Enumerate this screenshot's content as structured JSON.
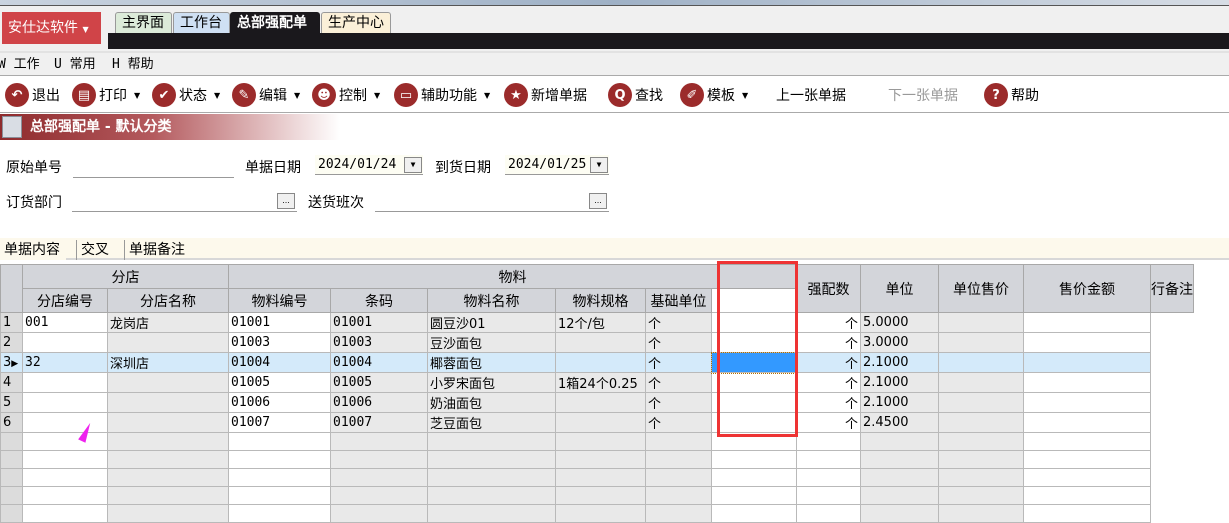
{
  "app": {
    "brand": "安仕达软件",
    "tabs": [
      {
        "label": "主界面",
        "bg": "#dcebd9"
      },
      {
        "label": "工作台",
        "bg": "#cfe0f3"
      },
      {
        "label": "总部强配单",
        "bg": "#1a181c"
      },
      {
        "label": "生产中心",
        "bg": "#fbf0d8"
      }
    ]
  },
  "menu": [
    "W 工作",
    "U 常用",
    "H 帮助"
  ],
  "toolbar": [
    {
      "label": "退出",
      "icon": "undo-icon",
      "glyph": "↶"
    },
    {
      "label": "打印",
      "icon": "printer-icon",
      "glyph": "▤",
      "dd": true
    },
    {
      "label": "状态",
      "icon": "check-icon",
      "glyph": "✔",
      "dd": true
    },
    {
      "label": "编辑",
      "icon": "pencil-icon",
      "glyph": "✎",
      "dd": true
    },
    {
      "label": "控制",
      "icon": "user-icon",
      "glyph": "☻",
      "dd": true
    },
    {
      "label": "辅助功能",
      "icon": "folder-icon",
      "glyph": "▭",
      "dd": true
    },
    {
      "label": "新增单据",
      "icon": "star-icon",
      "glyph": "★"
    },
    {
      "label": "查找",
      "icon": "search-icon",
      "glyph": "Q"
    },
    {
      "label": "模板",
      "icon": "eraser-icon",
      "glyph": "✐",
      "dd": true
    },
    {
      "label": "上一张单据"
    },
    {
      "label": "下一张单据",
      "disabled": true
    },
    {
      "label": "帮助",
      "icon": "help-icon",
      "glyph": "?"
    }
  ],
  "title": "总部强配单 - 默认分类",
  "form": {
    "orig_no_label": "原始单号",
    "orig_no": "",
    "doc_date_label": "单据日期",
    "doc_date": "2024/01/24",
    "arrive_date_label": "到货日期",
    "arrive_date": "2024/01/25",
    "dept_label": "订货部门",
    "dept": "",
    "shift_label": "送货班次",
    "shift": "",
    "ellipsis": "..."
  },
  "panel_tabs": [
    "单据内容",
    "交叉",
    "单据备注"
  ],
  "grid": {
    "groups": [
      "分店",
      "物料"
    ],
    "columns": [
      "分店编号",
      "分店名称",
      "物料编号",
      "条码",
      "物料名称",
      "物料规格",
      "基础单位",
      "强配数",
      "单位",
      "单位售价",
      "售价金额",
      "行备注"
    ],
    "rows": [
      [
        "1",
        "001",
        "龙岗店",
        "01001",
        "01001",
        "圆豆沙01",
        "12个/包",
        "个",
        "",
        "个",
        "5.0000",
        "",
        ""
      ],
      [
        "2",
        "",
        "",
        "01003",
        "01003",
        "豆沙面包",
        "",
        "个",
        "",
        "个",
        "3.0000",
        "",
        ""
      ],
      [
        "3",
        "32",
        "深圳店",
        "01004",
        "01004",
        "椰蓉面包",
        "",
        "个",
        "",
        "个",
        "2.1000",
        "",
        ""
      ],
      [
        "4",
        "",
        "",
        "01005",
        "01005",
        "小罗宋面包",
        "1箱24个0.25",
        "个",
        "",
        "个",
        "2.1000",
        "",
        ""
      ],
      [
        "5",
        "",
        "",
        "01006",
        "01006",
        "奶油面包",
        "",
        "个",
        "",
        "个",
        "2.1000",
        "",
        ""
      ],
      [
        "6",
        "",
        "",
        "01007",
        "01007",
        "芝豆面包",
        "",
        "个",
        "",
        "个",
        "2.4500",
        "",
        ""
      ]
    ],
    "selected_row": 3,
    "empty_rows": 5
  }
}
